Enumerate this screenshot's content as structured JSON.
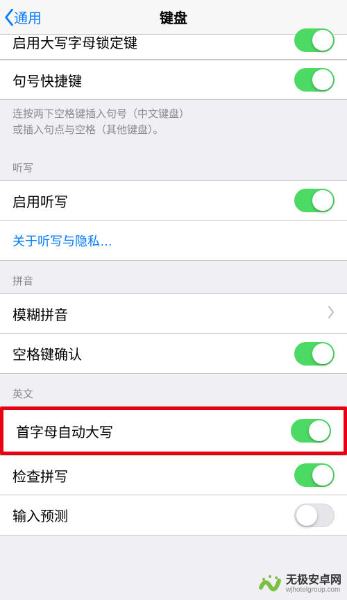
{
  "nav": {
    "back": "通用",
    "title": "键盘"
  },
  "rows": {
    "caps_lock": "启用大写字母锁定键",
    "period_shortcut": "句号快捷键",
    "period_footer_l1": "连按两下空格键插入句号（中文键盘）",
    "period_footer_l2": "或插入句点与空格（其他键盘）。",
    "dictation_header": "听写",
    "enable_dictation": "启用听写",
    "dictation_link": "关于听写与隐私…",
    "pinyin_header": "拼音",
    "fuzzy_pinyin": "模糊拼音",
    "space_confirm": "空格键确认",
    "english_header": "英文",
    "auto_cap": "首字母自动大写",
    "check_spelling": "检查拼写",
    "predictive": "输入预测"
  },
  "watermark": {
    "line1": "无极安卓网",
    "line2": "wjhotelgroup.com"
  }
}
